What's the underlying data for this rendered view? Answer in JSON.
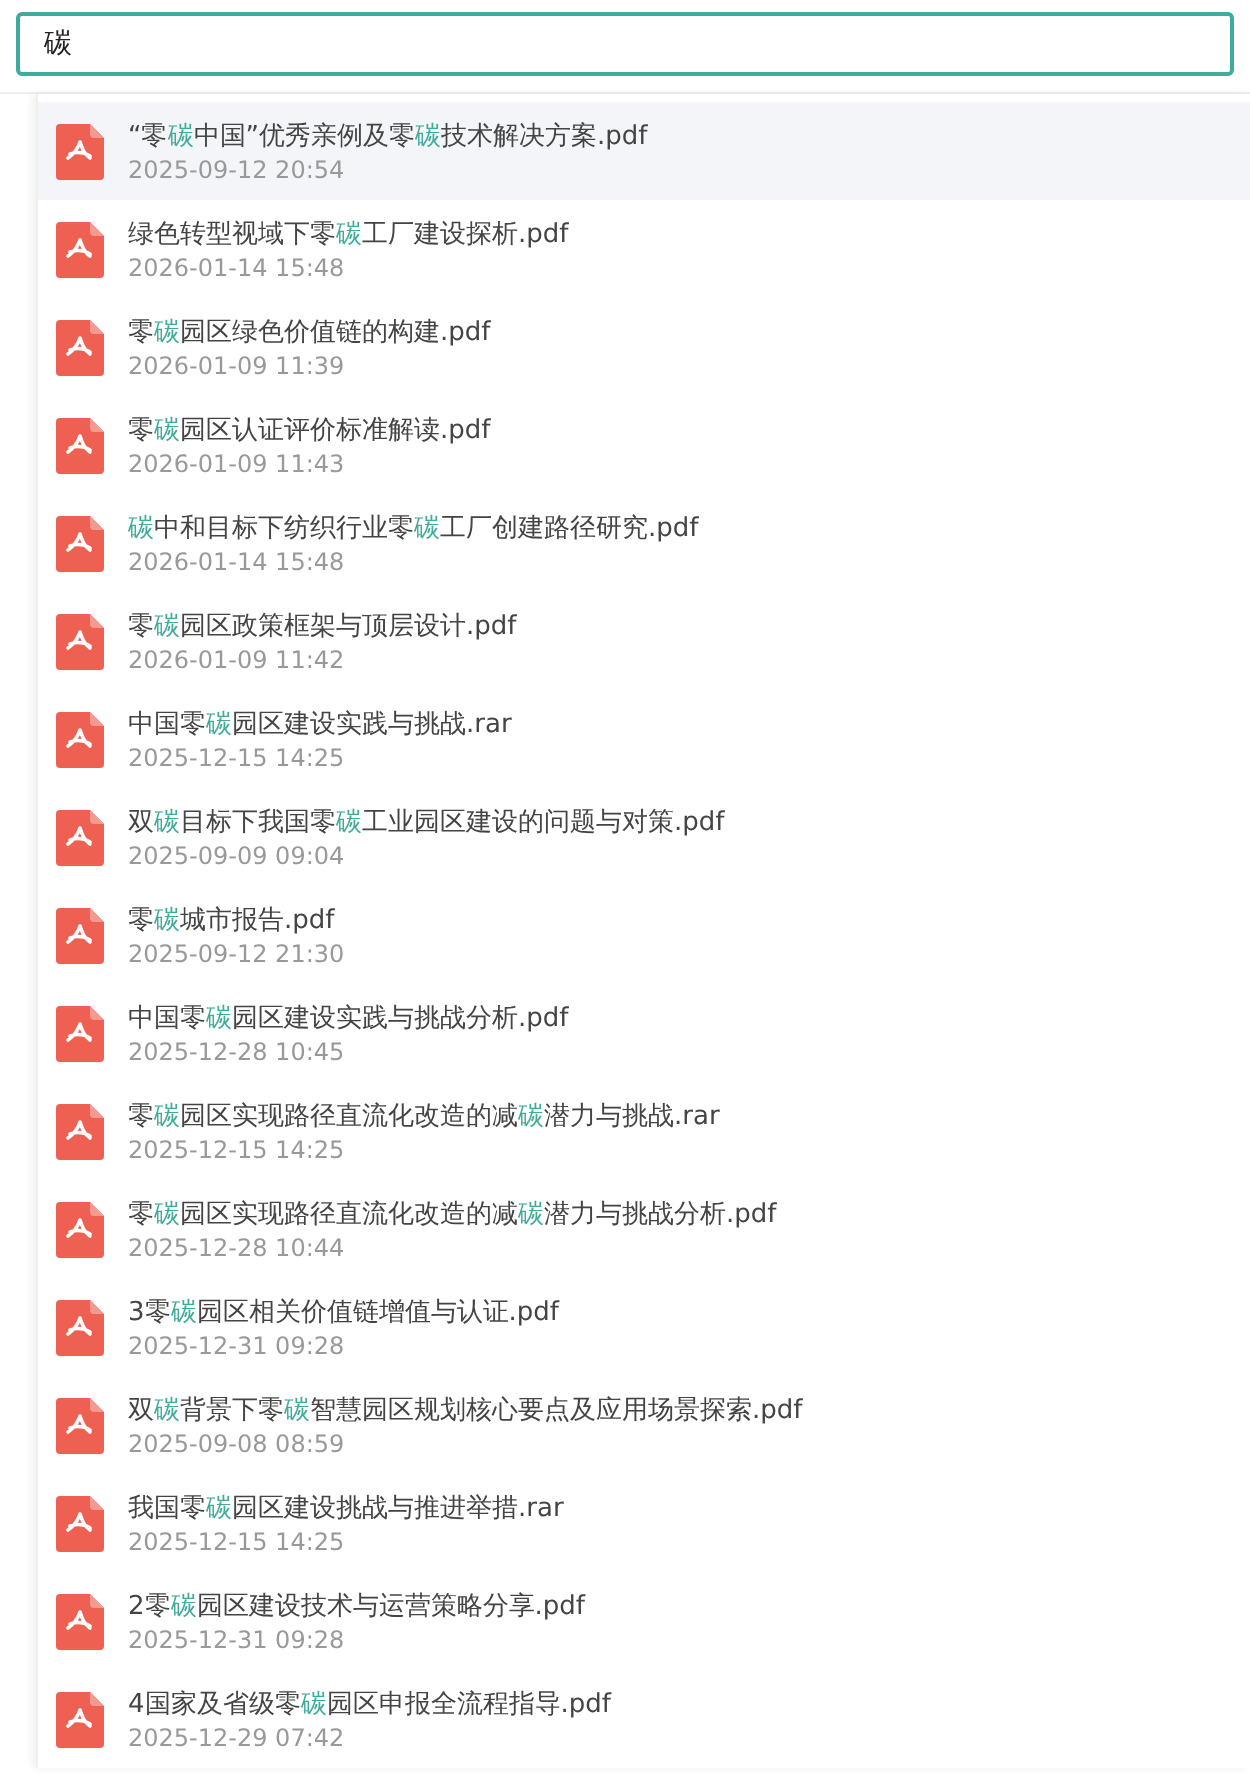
{
  "search": {
    "value": "碳"
  },
  "results": [
    {
      "selected": true,
      "parts": [
        {
          "text": "“零",
          "match": false
        },
        {
          "text": "碳",
          "match": true
        },
        {
          "text": "中国”优秀亲例及零",
          "match": false
        },
        {
          "text": "碳",
          "match": true
        },
        {
          "text": "技术解决方案.pdf",
          "match": false
        }
      ],
      "date": "2025-09-12 20:54"
    },
    {
      "selected": false,
      "parts": [
        {
          "text": "绿色转型视域下零",
          "match": false
        },
        {
          "text": "碳",
          "match": true
        },
        {
          "text": "工厂建设探析.pdf",
          "match": false
        }
      ],
      "date": "2026-01-14 15:48"
    },
    {
      "selected": false,
      "parts": [
        {
          "text": "零",
          "match": false
        },
        {
          "text": "碳",
          "match": true
        },
        {
          "text": "园区绿色价值链的构建.pdf",
          "match": false
        }
      ],
      "date": "2026-01-09 11:39"
    },
    {
      "selected": false,
      "parts": [
        {
          "text": "零",
          "match": false
        },
        {
          "text": "碳",
          "match": true
        },
        {
          "text": "园区认证评价标准解读.pdf",
          "match": false
        }
      ],
      "date": "2026-01-09 11:43"
    },
    {
      "selected": false,
      "parts": [
        {
          "text": "碳",
          "match": true
        },
        {
          "text": "中和目标下纺织行业零",
          "match": false
        },
        {
          "text": "碳",
          "match": true
        },
        {
          "text": "工厂创建路径研究.pdf",
          "match": false
        }
      ],
      "date": "2026-01-14 15:48"
    },
    {
      "selected": false,
      "parts": [
        {
          "text": "零",
          "match": false
        },
        {
          "text": "碳",
          "match": true
        },
        {
          "text": "园区政策框架与顶层设计.pdf",
          "match": false
        }
      ],
      "date": "2026-01-09 11:42"
    },
    {
      "selected": false,
      "parts": [
        {
          "text": "中国零",
          "match": false
        },
        {
          "text": "碳",
          "match": true
        },
        {
          "text": "园区建设实践与挑战.rar",
          "match": false
        }
      ],
      "date": "2025-12-15 14:25"
    },
    {
      "selected": false,
      "parts": [
        {
          "text": "双",
          "match": false
        },
        {
          "text": "碳",
          "match": true
        },
        {
          "text": "目标下我国零",
          "match": false
        },
        {
          "text": "碳",
          "match": true
        },
        {
          "text": "工业园区建设的问题与对策.pdf",
          "match": false
        }
      ],
      "date": "2025-09-09 09:04"
    },
    {
      "selected": false,
      "parts": [
        {
          "text": "零",
          "match": false
        },
        {
          "text": "碳",
          "match": true
        },
        {
          "text": "城市报告.pdf",
          "match": false
        }
      ],
      "date": "2025-09-12 21:30"
    },
    {
      "selected": false,
      "parts": [
        {
          "text": "中国零",
          "match": false
        },
        {
          "text": "碳",
          "match": true
        },
        {
          "text": "园区建设实践与挑战分析.pdf",
          "match": false
        }
      ],
      "date": "2025-12-28 10:45"
    },
    {
      "selected": false,
      "parts": [
        {
          "text": "零",
          "match": false
        },
        {
          "text": "碳",
          "match": true
        },
        {
          "text": "园区实现路径直流化改造的减",
          "match": false
        },
        {
          "text": "碳",
          "match": true
        },
        {
          "text": "潜力与挑战.rar",
          "match": false
        }
      ],
      "date": "2025-12-15 14:25"
    },
    {
      "selected": false,
      "parts": [
        {
          "text": "零",
          "match": false
        },
        {
          "text": "碳",
          "match": true
        },
        {
          "text": "园区实现路径直流化改造的减",
          "match": false
        },
        {
          "text": "碳",
          "match": true
        },
        {
          "text": "潜力与挑战分析.pdf",
          "match": false
        }
      ],
      "date": "2025-12-28 10:44"
    },
    {
      "selected": false,
      "parts": [
        {
          "text": "3零",
          "match": false
        },
        {
          "text": "碳",
          "match": true
        },
        {
          "text": "园区相关价值链增值与认证.pdf",
          "match": false
        }
      ],
      "date": "2025-12-31 09:28"
    },
    {
      "selected": false,
      "parts": [
        {
          "text": "双",
          "match": false
        },
        {
          "text": "碳",
          "match": true
        },
        {
          "text": "背景下零",
          "match": false
        },
        {
          "text": "碳",
          "match": true
        },
        {
          "text": "智慧园区规划核心要点及应用场景探索.pdf",
          "match": false
        }
      ],
      "date": "2025-09-08 08:59"
    },
    {
      "selected": false,
      "parts": [
        {
          "text": "我国零",
          "match": false
        },
        {
          "text": "碳",
          "match": true
        },
        {
          "text": "园区建设挑战与推进举措.rar",
          "match": false
        }
      ],
      "date": "2025-12-15 14:25"
    },
    {
      "selected": false,
      "parts": [
        {
          "text": "2零",
          "match": false
        },
        {
          "text": "碳",
          "match": true
        },
        {
          "text": "园区建设技术与运营策略分享.pdf",
          "match": false
        }
      ],
      "date": "2025-12-31 09:28"
    },
    {
      "selected": false,
      "parts": [
        {
          "text": "4国家及省级零",
          "match": false
        },
        {
          "text": "碳",
          "match": true
        },
        {
          "text": "园区申报全流程指导.pdf",
          "match": false
        }
      ],
      "date": "2025-12-29 07:42"
    }
  ]
}
